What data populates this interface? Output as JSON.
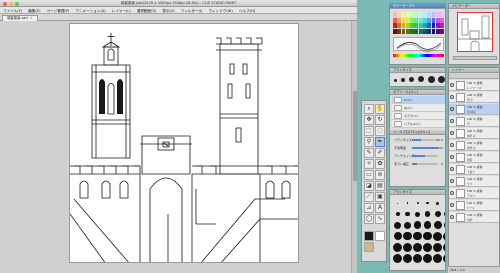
{
  "window": {
    "title": "城塞風景.psd(2576 x 3000px 350dpi 28.8%) - CLIP STUDIO PAINT",
    "document_tab": "城塞風景.psd",
    "menus": [
      "ファイル(F)",
      "編集(E)",
      "ページ管理(P)",
      "アニメーション(A)",
      "レイヤー(L)",
      "選択範囲(S)",
      "表示(V)",
      "フィルター(I)",
      "ウィンドウ(W)",
      "ヘルプ(H)"
    ]
  },
  "panels": {
    "color_title": "カラーサークル",
    "navigator_title": "ナビゲーター",
    "brush_title": "ブラシサイズ",
    "subtool_title": "サブツール[ペン]",
    "tool_property_title": "ツールプロパティ[Gペン]",
    "brush_size_title": "ブラシサイズ",
    "layer_title": "レイヤー"
  },
  "subtools": [
    {
      "label": "Gペン",
      "selected": true
    },
    {
      "label": "丸ペン",
      "selected": false
    },
    {
      "label": "カブラペン",
      "selected": false
    },
    {
      "label": "リアルGペン",
      "selected": false
    }
  ],
  "tool_properties": [
    {
      "label": "ブラシサイズ",
      "value": "10.0",
      "fill": 0.35
    },
    {
      "label": "不透明度",
      "value": "100",
      "fill": 1.0
    },
    {
      "label": "アンチエイリアス",
      "value": "",
      "fill": 0.5
    },
    {
      "label": "手ブレ補正",
      "value": "9",
      "fill": 0.18
    }
  ],
  "layers": [
    {
      "name": "100 % 通常",
      "mode": "レイヤー 12",
      "selected": false
    },
    {
      "name": "100 % 通常",
      "mode": "塔 窓",
      "selected": false
    },
    {
      "name": "100 % 通常",
      "mode": "塔 線画",
      "selected": true
    },
    {
      "name": "100 % 通常",
      "mode": "門",
      "selected": false
    },
    {
      "name": "100 % 通常",
      "mode": "城壁 右",
      "selected": false
    },
    {
      "name": "100 % 通常",
      "mode": "城壁 左",
      "selected": false
    },
    {
      "name": "100 % 通常",
      "mode": "地面",
      "selected": false
    },
    {
      "name": "100 % 通常",
      "mode": "下書き",
      "selected": false
    },
    {
      "name": "100 % 通常",
      "mode": "ラフ",
      "selected": false
    },
    {
      "name": "100 % 通常",
      "mode": "アタリ",
      "selected": false
    },
    {
      "name": "100 % 通常",
      "mode": "パース",
      "selected": false
    },
    {
      "name": "100 % 通常",
      "mode": "用紙",
      "selected": false
    }
  ],
  "status": "28.8  ◇ 0.0",
  "colors": {
    "desktop": "#7ab9b4",
    "accent": "#5983c6",
    "selection": "#b9d2f3"
  }
}
